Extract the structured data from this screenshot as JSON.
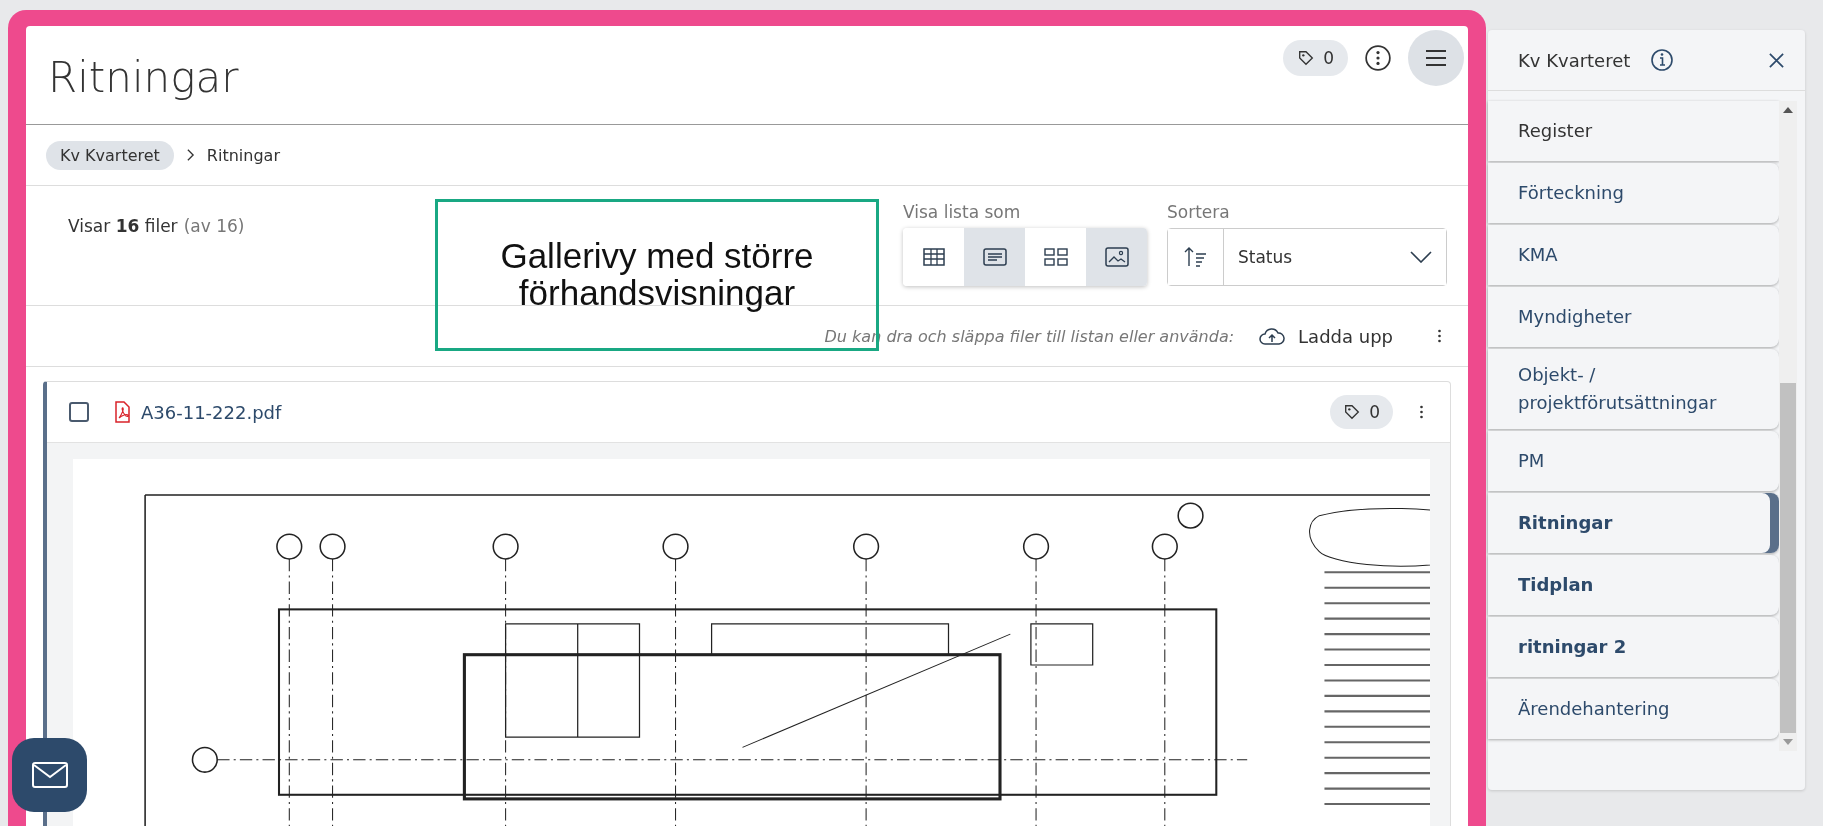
{
  "page": {
    "title": "Ritningar",
    "tag_count": "0"
  },
  "breadcrumb": [
    {
      "label": "Kv Kvarteret",
      "kind": "chip"
    },
    {
      "label": "Ritningar",
      "kind": "current"
    }
  ],
  "summary": {
    "text": "Visar **16** filer",
    "total": "(av 16)"
  },
  "annotation": "Gallerivy med större förhandsvisningar",
  "view": {
    "label": "Visa lista som",
    "options": [
      {
        "kind": "table",
        "selected": false
      },
      {
        "kind": "list",
        "selected": true
      },
      {
        "kind": "grid",
        "selected": false
      },
      {
        "kind": "gallery",
        "selected": true
      }
    ]
  },
  "sort": {
    "label": "Sortera",
    "value": "Status"
  },
  "upload": {
    "hint": "Du kan dra och släppa filer till listan eller använda:",
    "button": "Ladda upp"
  },
  "files": [
    {
      "name": "A36-11-222.pdf",
      "checked": false,
      "tag_count": "0"
    }
  ],
  "sidebar": {
    "title": "Kv Kvarteret",
    "items": [
      {
        "label": "Register",
        "kind": "root",
        "selected": false,
        "unread": false
      },
      {
        "label": "Förteckning",
        "kind": "folder",
        "selected": false,
        "unread": false
      },
      {
        "label": "KMA",
        "kind": "folder",
        "selected": false,
        "unread": false
      },
      {
        "label": "Myndigheter",
        "kind": "folder",
        "selected": false,
        "unread": false
      },
      {
        "label": "Objekt- / projektförutsättningar",
        "kind": "folder",
        "selected": false,
        "unread": false
      },
      {
        "label": "PM",
        "kind": "folder",
        "selected": false,
        "unread": false
      },
      {
        "label": "Ritningar",
        "kind": "folder",
        "selected": true,
        "unread": true
      },
      {
        "label": "Tidplan",
        "kind": "folder",
        "selected": false,
        "unread": true
      },
      {
        "label": "ritningar 2",
        "kind": "folder",
        "selected": false,
        "unread": true
      },
      {
        "label": "Ärendehantering",
        "kind": "folder",
        "selected": false,
        "unread": false
      }
    ]
  }
}
